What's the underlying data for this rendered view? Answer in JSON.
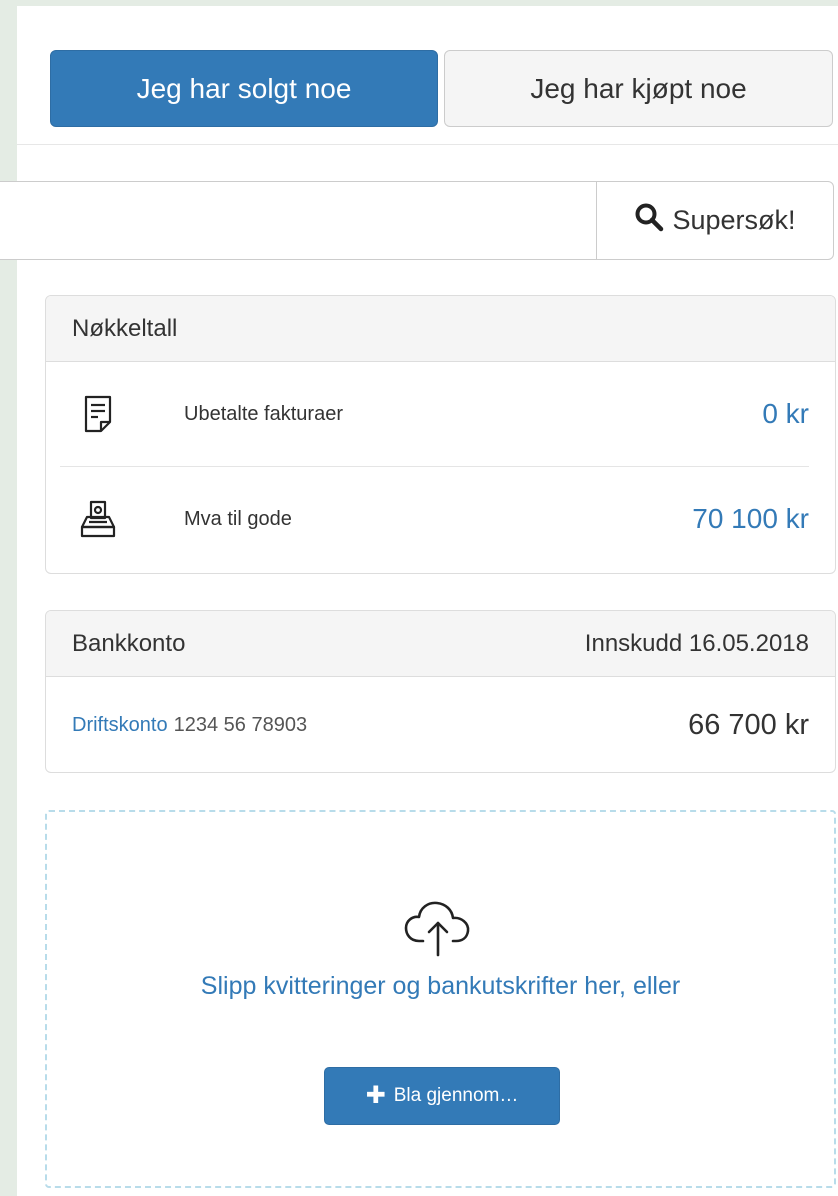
{
  "toggle": {
    "sold_label": "Jeg har solgt noe",
    "bought_label": "Jeg har kjøpt noe"
  },
  "search": {
    "value": "",
    "button_label": "Supersøk!",
    "button_icon": "search-icon"
  },
  "key_figures": {
    "title": "Nøkkeltall",
    "rows": [
      {
        "icon": "invoice-icon",
        "label": "Ubetalte fakturaer",
        "value": "0 kr"
      },
      {
        "icon": "tax-box-icon",
        "label": "Mva til gode",
        "value": "70 100 kr"
      }
    ]
  },
  "bank": {
    "title": "Bankkonto",
    "deposit_label": "Innskudd 16.05.2018",
    "account_name": "Driftskonto",
    "account_number": "1234 56 78903",
    "amount": "66 700 kr"
  },
  "dropzone": {
    "icon": "cloud-upload-icon",
    "text": "Slipp kvitteringer og bankutskrifter her, eller",
    "browse_label": "Bla gjennom…",
    "browse_icon": "plus-icon"
  },
  "colors": {
    "primary": "#337ab7",
    "page_background": "#e4ece4",
    "dropzone_border": "#b8dcea"
  }
}
